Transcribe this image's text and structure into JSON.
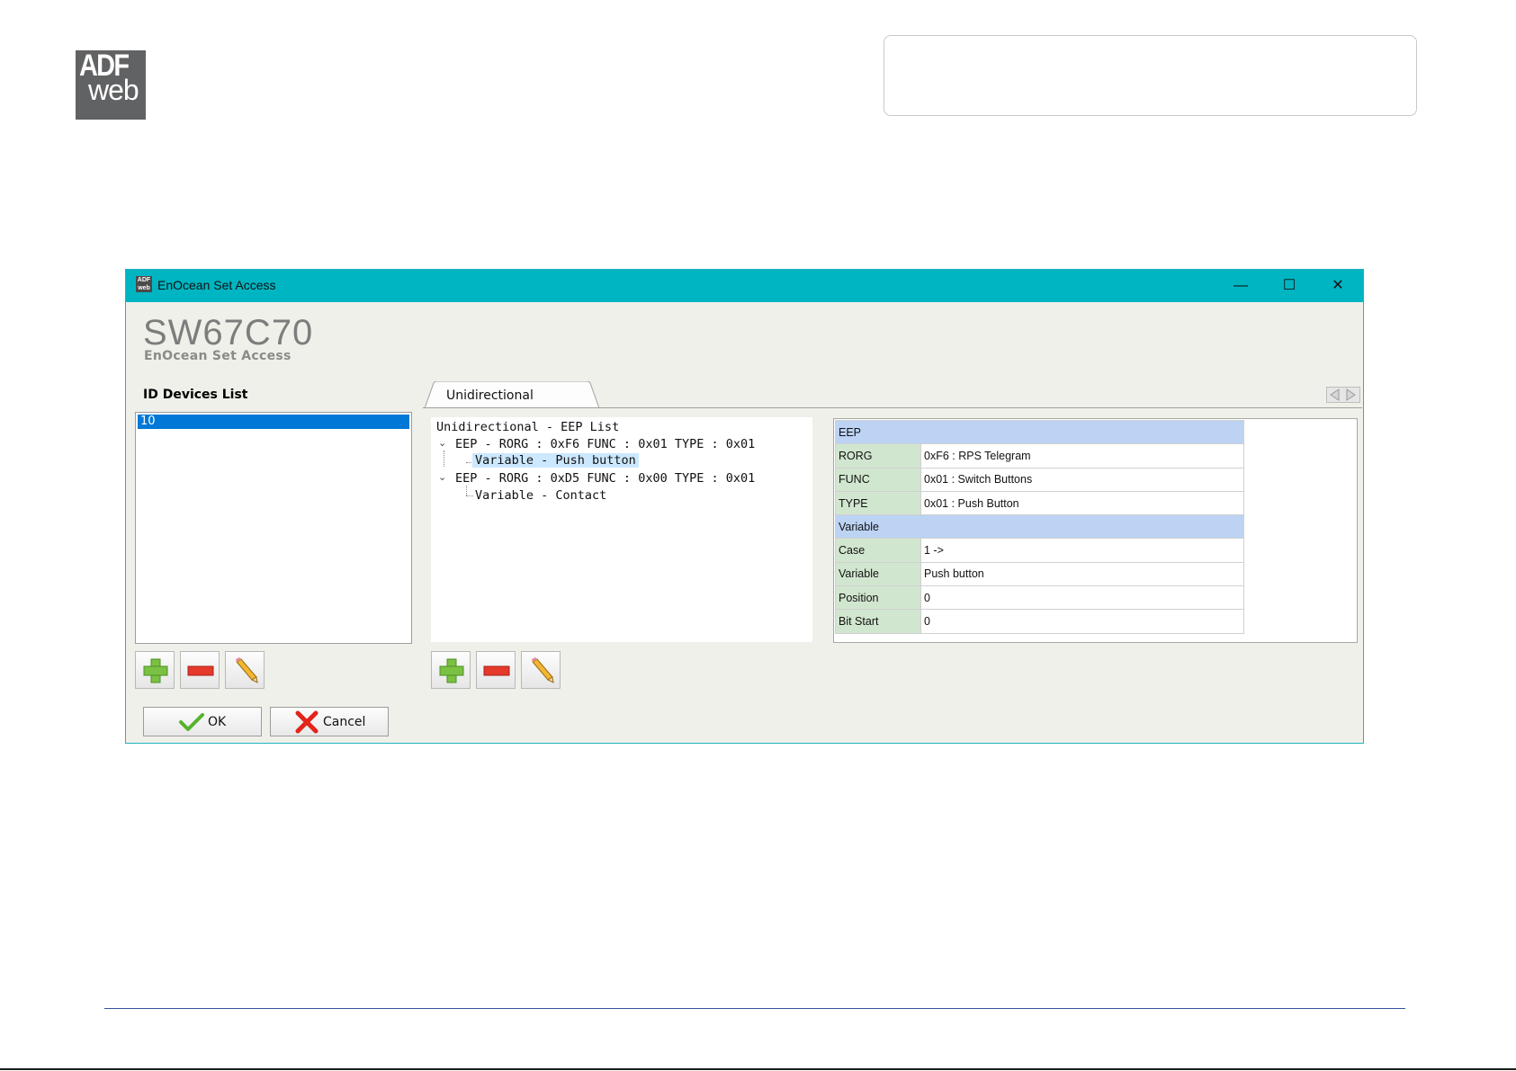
{
  "logo": {
    "line1": "ADF",
    "line2": "web"
  },
  "window": {
    "title": "EnOcean Set Access",
    "app_icon": "adf-web-icon",
    "controls": {
      "minimize": "—",
      "maximize": "☐",
      "close": "✕"
    }
  },
  "header": {
    "product": "SW67C70",
    "subtitle": "EnOcean Set Access"
  },
  "id_list": {
    "title": "ID Devices List",
    "items": [
      "10"
    ]
  },
  "tabs": [
    {
      "label": "Unidirectional"
    }
  ],
  "tree": {
    "root": "Unidirectional - EEP List",
    "nodes": [
      {
        "label": "EEP - RORG : 0xF6 FUNC : 0x01 TYPE : 0x01",
        "child": "Variable - Push button"
      },
      {
        "label": "EEP - RORG : 0xD5 FUNC : 0x00 TYPE : 0x01",
        "child": "Variable - Contact"
      }
    ]
  },
  "properties": {
    "eep_header": "EEP",
    "variable_header": "Variable",
    "eep_rows": [
      {
        "key": "RORG",
        "value": "0xF6 : RPS Telegram"
      },
      {
        "key": "FUNC",
        "value": "0x01 : Switch Buttons"
      },
      {
        "key": "TYPE",
        "value": "0x01 : Push Button"
      }
    ],
    "variable_rows": [
      {
        "key": "Case",
        "value": "1 ->"
      },
      {
        "key": "Variable",
        "value": "Push button"
      },
      {
        "key": "Position",
        "value": "0"
      },
      {
        "key": "Bit Start",
        "value": "0"
      }
    ]
  },
  "buttons": {
    "ok": "OK",
    "cancel": "Cancel"
  },
  "colors": {
    "titlebar": "#00b5c2",
    "selection": "#0078d7",
    "grid_header": "#bcd3f4",
    "grid_key": "#d1e6cf"
  }
}
